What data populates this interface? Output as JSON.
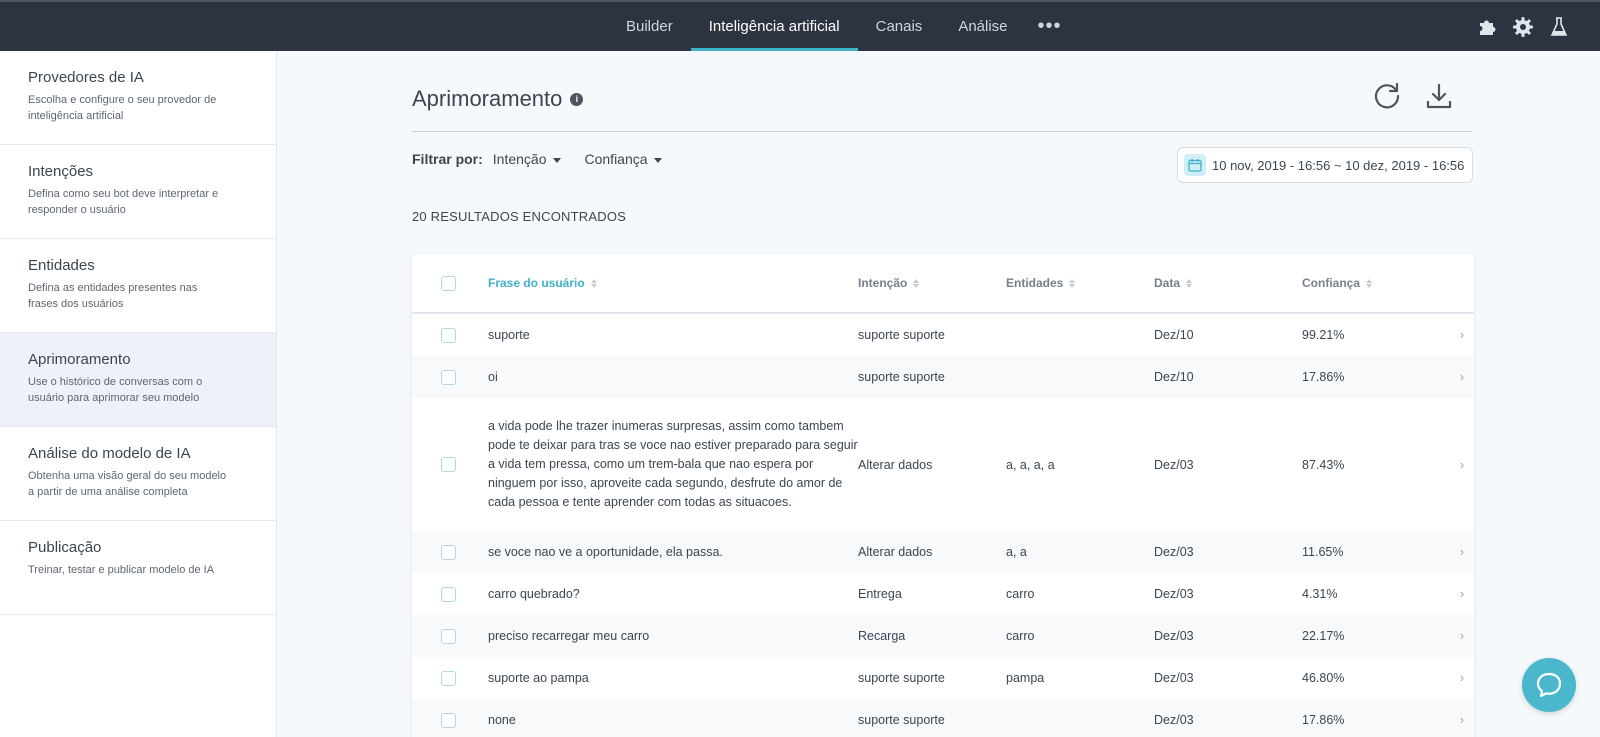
{
  "topnav": {
    "items": [
      {
        "label": "Builder"
      },
      {
        "label": "Inteligência artificial",
        "active": true
      },
      {
        "label": "Canais"
      },
      {
        "label": "Análise"
      }
    ],
    "more_label": "•••",
    "icons": [
      "puzzle-icon",
      "gear-icon",
      "flask-icon"
    ]
  },
  "sidebar": {
    "items": [
      {
        "title": "Provedores de IA",
        "desc": "Escolha e configure o seu provedor de inteligência artificial"
      },
      {
        "title": "Intenções",
        "desc": "Defina como seu bot deve interpretar e responder o usuário"
      },
      {
        "title": "Entidades",
        "desc": "Defina as entidades presentes nas frases dos usuários"
      },
      {
        "title": "Aprimoramento",
        "desc": "Use o histórico de conversas com o usuário para aprimorar seu modelo",
        "active": true
      },
      {
        "title": "Análise do modelo de IA",
        "desc": "Obtenha uma visão geral do seu modelo a partir de uma análise completa"
      },
      {
        "title": "Publicação",
        "desc": "Treinar, testar e publicar modelo de IA"
      }
    ]
  },
  "main": {
    "title": "Aprimoramento",
    "filter_label": "Filtrar por:",
    "filters": [
      "Intenção",
      "Confiança"
    ],
    "date_range": "10 nov, 2019 - 16:56 ~  10 dez, 2019 - 16:56",
    "results": "20 RESULTADOS ENCONTRADOS"
  },
  "table": {
    "headers": {
      "frase": "Frase do usuário",
      "intencao": "Intenção",
      "entidades": "Entidades",
      "data": "Data",
      "confianca": "Confiança"
    },
    "rows": [
      {
        "frase": "suporte",
        "intencao": "suporte suporte",
        "entidades": "",
        "data": "Dez/10",
        "confianca": "99.21%"
      },
      {
        "frase": "oi",
        "intencao": "suporte suporte",
        "entidades": "",
        "data": "Dez/10",
        "confianca": "17.86%"
      },
      {
        "frase": "a vida pode lhe trazer inumeras surpresas, assim como tambem pode te deixar para tras se voce nao estiver preparado para seguir a vida tem pressa, como um trem-bala que nao espera por ninguem por isso, aproveite cada segundo, desfrute do amor de cada pessoa e tente aprender com todas as situacoes.",
        "intencao": "Alterar dados",
        "entidades": "a, a, a, a",
        "data": "Dez/03",
        "confianca": "87.43%"
      },
      {
        "frase": "se voce nao ve a oportunidade, ela passa.",
        "intencao": "Alterar dados",
        "entidades": "a, a",
        "data": "Dez/03",
        "confianca": "11.65%"
      },
      {
        "frase": "carro quebrado?",
        "intencao": "Entrega",
        "entidades": "carro",
        "data": "Dez/03",
        "confianca": "4.31%"
      },
      {
        "frase": "preciso recarregar meu carro",
        "intencao": "Recarga",
        "entidades": "carro",
        "data": "Dez/03",
        "confianca": "22.17%"
      },
      {
        "frase": "suporte ao pampa",
        "intencao": "suporte suporte",
        "entidades": "pampa",
        "data": "Dez/03",
        "confianca": "46.80%"
      },
      {
        "frase": "none",
        "intencao": "suporte suporte",
        "entidades": "",
        "data": "Dez/03",
        "confianca": "17.86%"
      }
    ]
  },
  "colors": {
    "accent": "#3fb2c9",
    "topbar": "#2b3440",
    "sidebar_active": "#eef1f7"
  }
}
